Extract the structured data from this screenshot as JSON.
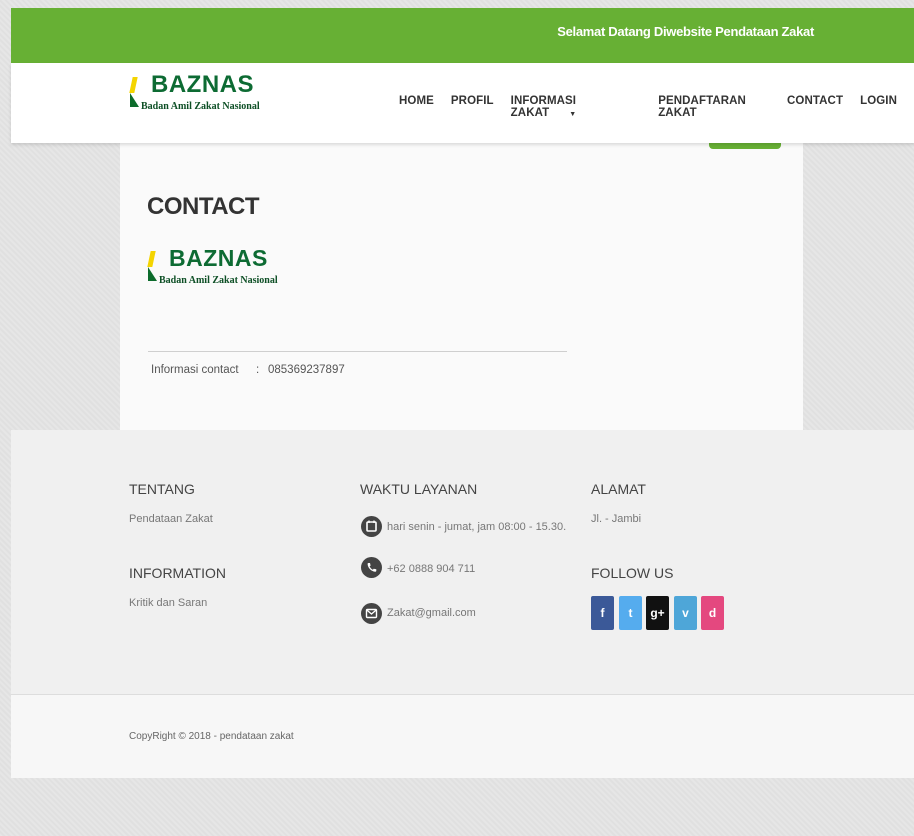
{
  "topbar": {
    "welcome": "Selamat Datang Diwebsite Pendataan Zakat"
  },
  "brand": {
    "name": "BAZNAS",
    "subtitle": "Badan Amil Zakat Nasional"
  },
  "nav": {
    "home": "HOME",
    "profil": "PROFIL",
    "informasi": "INFORMASI ZAKAT",
    "pendaftaran": "PENDAFTARAN ZAKAT",
    "contact": "CONTACT",
    "login": "LOGIN"
  },
  "content": {
    "title": "CONTACT",
    "info_label": "Informasi contact",
    "info_colon": ":",
    "info_value": "085369237897"
  },
  "footer": {
    "tentang": {
      "heading": "TENTANG",
      "text": "Pendataan Zakat"
    },
    "information": {
      "heading": "INFORMATION",
      "text": "Kritik dan Saran"
    },
    "waktu": {
      "heading": "WAKTU LAYANAN",
      "hours": "hari senin - jumat, jam 08:00 - 15.30.",
      "phone": "+62 0888 904 711",
      "email": "Zakat@gmail.com"
    },
    "alamat": {
      "heading": "ALAMAT",
      "text": "Jl. - Jambi"
    },
    "follow": {
      "heading": "FOLLOW US",
      "facebook": "f",
      "twitter": "t",
      "googleplus": "g+",
      "vimeo": "v",
      "dribbble": "d"
    },
    "copyright": "CopyRight © 2018 - pendataan zakat"
  },
  "colors": {
    "brand_green": "#67b034",
    "facebook": "#3b5998",
    "twitter": "#55acee",
    "googleplus": "#111111",
    "vimeo": "#4ea6d8",
    "dribbble": "#e4487f"
  }
}
